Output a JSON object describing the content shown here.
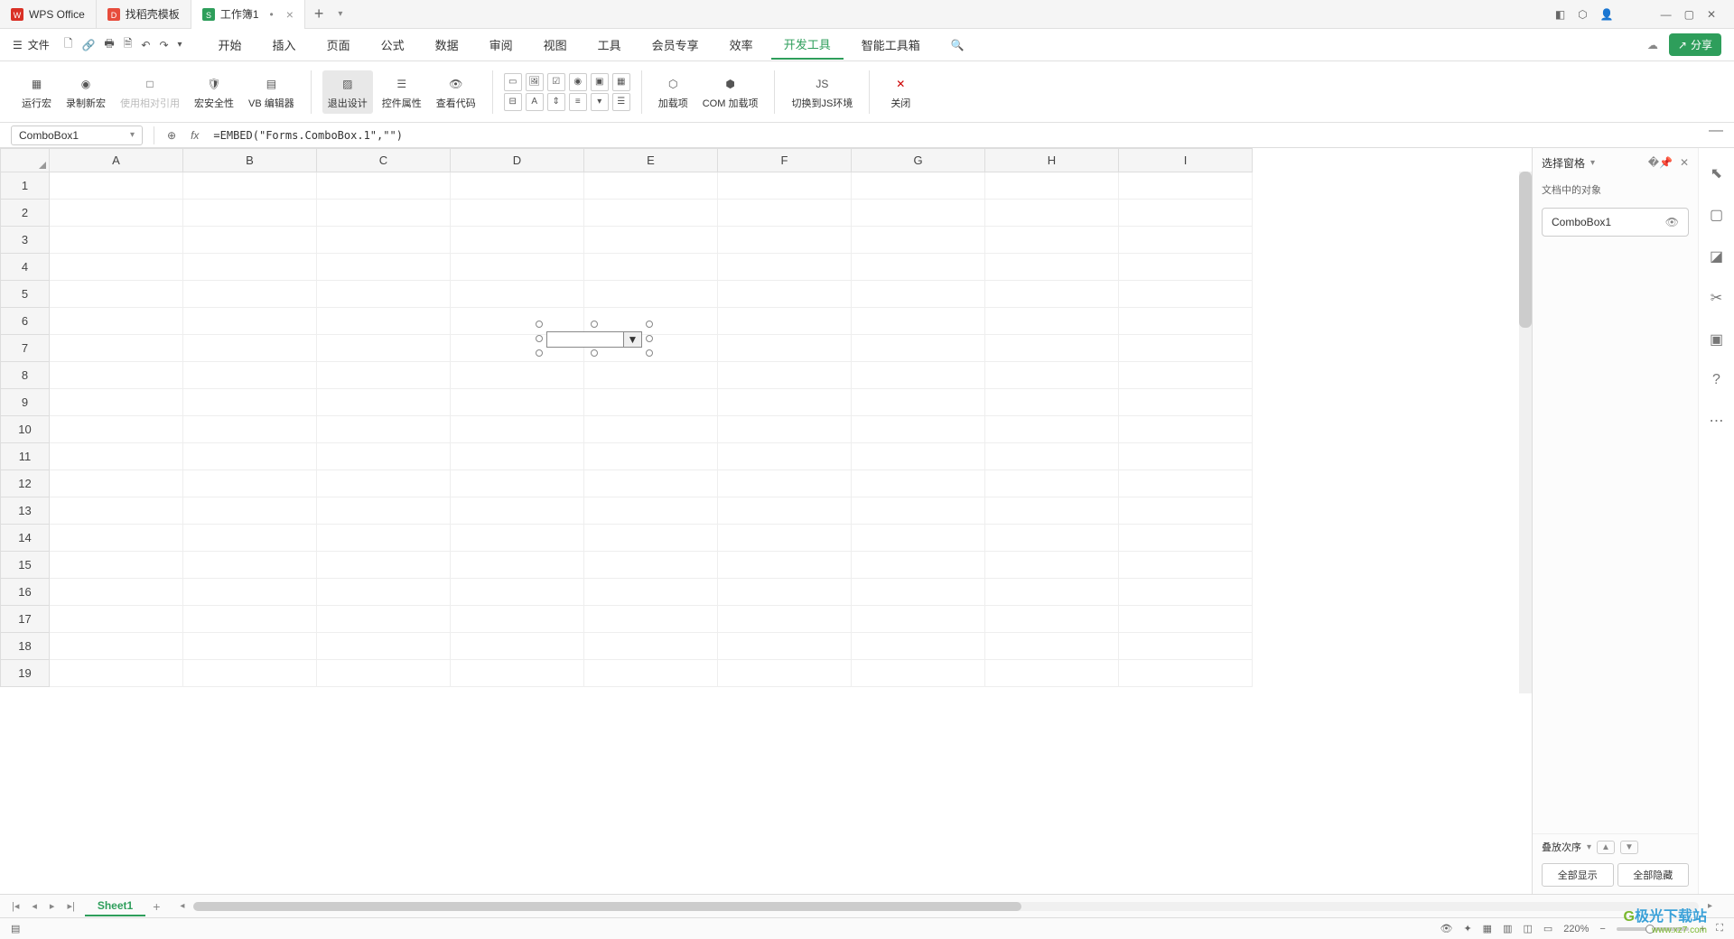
{
  "titlebar": {
    "tabs": [
      {
        "label": "WPS Office",
        "icon": "wps",
        "color": "#d93025"
      },
      {
        "label": "找稻壳模板",
        "icon": "docer",
        "color": "#d93025"
      },
      {
        "label": "工作簿1",
        "icon": "sheet",
        "color": "#2e9e5b",
        "active": true,
        "modified": true
      }
    ]
  },
  "menubar": {
    "file": "文件",
    "items": [
      "开始",
      "插入",
      "页面",
      "公式",
      "数据",
      "审阅",
      "视图",
      "工具",
      "会员专享",
      "效率",
      "开发工具",
      "智能工具箱"
    ],
    "active": "开发工具",
    "share": "分享"
  },
  "ribbon": {
    "groups": [
      {
        "label": "运行宏"
      },
      {
        "label": "录制新宏"
      },
      {
        "label": "使用相对引用",
        "disabled": true
      },
      {
        "label": "宏安全性"
      },
      {
        "label": "VB 编辑器"
      },
      {
        "label": "退出设计",
        "active": true
      },
      {
        "label": "控件属性"
      },
      {
        "label": "查看代码"
      },
      {
        "label": "加载项"
      },
      {
        "label": "COM 加载项"
      },
      {
        "label": "切换到JS环境"
      },
      {
        "label": "关闭"
      }
    ]
  },
  "formulabar": {
    "namebox": "ComboBox1",
    "formula": "=EMBED(\"Forms.ComboBox.1\",\"\")"
  },
  "grid": {
    "columns": [
      "A",
      "B",
      "C",
      "D",
      "E",
      "F",
      "G",
      "H",
      "I"
    ],
    "rows": [
      1,
      2,
      3,
      4,
      5,
      6,
      7,
      8,
      9,
      10,
      11,
      12,
      13,
      14,
      15,
      16,
      17,
      18,
      19
    ]
  },
  "panel": {
    "title": "选择窗格",
    "subtitle": "文档中的对象",
    "items": [
      "ComboBox1"
    ],
    "order_label": "叠放次序",
    "show_all": "全部显示",
    "hide_all": "全部隐藏"
  },
  "sheettabs": {
    "active": "Sheet1"
  },
  "statusbar": {
    "zoom": "220%"
  },
  "watermark": {
    "name": "极光下载站",
    "url": "www.xz7.com"
  }
}
